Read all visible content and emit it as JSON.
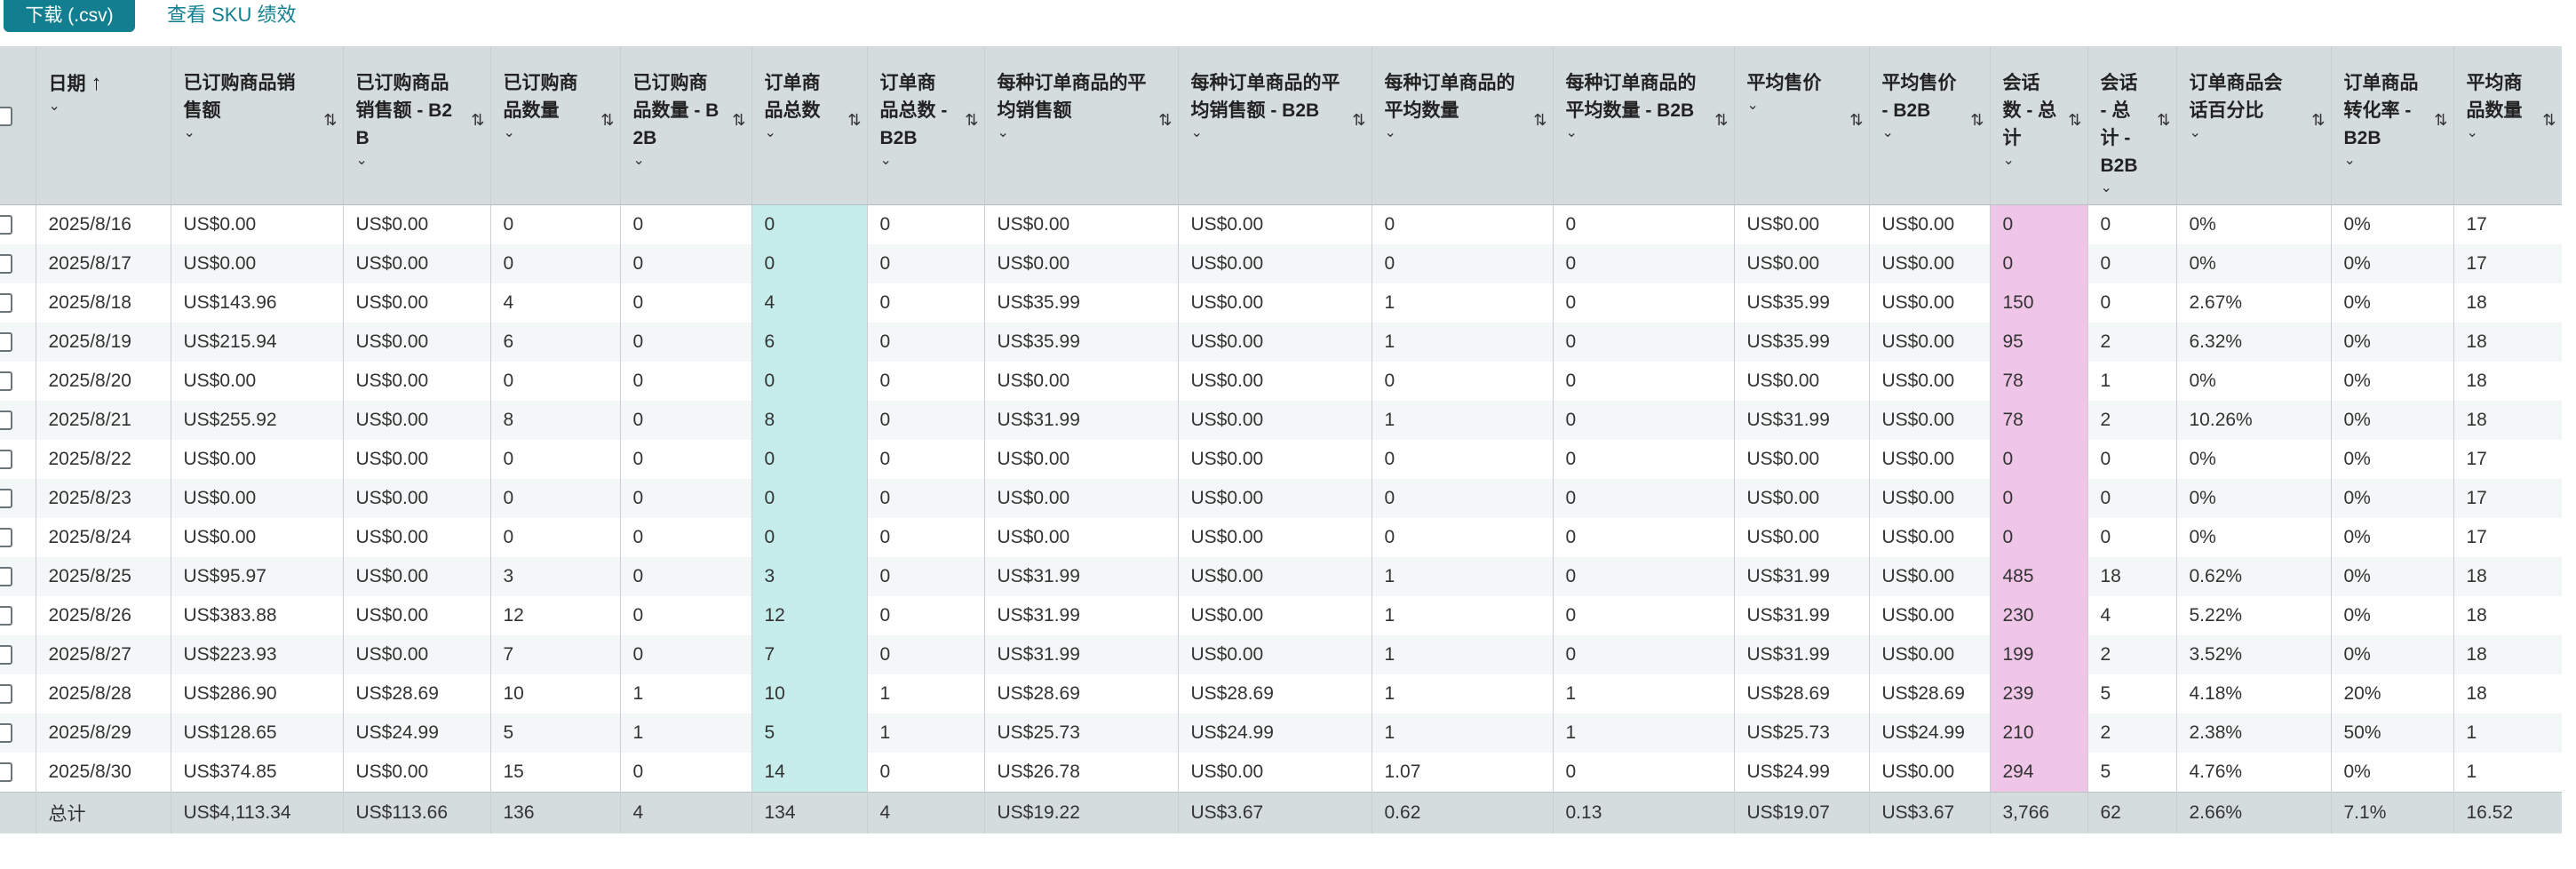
{
  "toolbar": {
    "download_label": "下载 (.csv)",
    "sku_link_label": "查看 SKU 绩效"
  },
  "table": {
    "columns": [
      {
        "label": "日期",
        "sort": "asc"
      },
      {
        "label": "已订购商品销售额"
      },
      {
        "label": "已订购商品销售额 - B2B"
      },
      {
        "label": "已订购商品数量"
      },
      {
        "label": "已订购商品数量 - B2B"
      },
      {
        "label": "订单商品总数"
      },
      {
        "label": "订单商品总数 - B2B"
      },
      {
        "label": "每种订单商品的平均销售额"
      },
      {
        "label": "每种订单商品的平均销售额 - B2B"
      },
      {
        "label": "每种订单商品的平均数量"
      },
      {
        "label": "每种订单商品的平均数量 - B2B"
      },
      {
        "label": "平均售价"
      },
      {
        "label": "平均售价 - B2B"
      },
      {
        "label": "会话数 - 总计"
      },
      {
        "label": "会话 - 总计 - B2B"
      },
      {
        "label": "订单商品会话百分比"
      },
      {
        "label": "订单商品转化率 - B2B"
      },
      {
        "label": "平均商品数量"
      }
    ],
    "rows": [
      [
        "2025/8/16",
        "US$0.00",
        "US$0.00",
        "0",
        "0",
        "0",
        "0",
        "US$0.00",
        "US$0.00",
        "0",
        "0",
        "US$0.00",
        "US$0.00",
        "0",
        "0",
        "0%",
        "0%",
        "17"
      ],
      [
        "2025/8/17",
        "US$0.00",
        "US$0.00",
        "0",
        "0",
        "0",
        "0",
        "US$0.00",
        "US$0.00",
        "0",
        "0",
        "US$0.00",
        "US$0.00",
        "0",
        "0",
        "0%",
        "0%",
        "17"
      ],
      [
        "2025/8/18",
        "US$143.96",
        "US$0.00",
        "4",
        "0",
        "4",
        "0",
        "US$35.99",
        "US$0.00",
        "1",
        "0",
        "US$35.99",
        "US$0.00",
        "150",
        "0",
        "2.67%",
        "0%",
        "18"
      ],
      [
        "2025/8/19",
        "US$215.94",
        "US$0.00",
        "6",
        "0",
        "6",
        "0",
        "US$35.99",
        "US$0.00",
        "1",
        "0",
        "US$35.99",
        "US$0.00",
        "95",
        "2",
        "6.32%",
        "0%",
        "18"
      ],
      [
        "2025/8/20",
        "US$0.00",
        "US$0.00",
        "0",
        "0",
        "0",
        "0",
        "US$0.00",
        "US$0.00",
        "0",
        "0",
        "US$0.00",
        "US$0.00",
        "78",
        "1",
        "0%",
        "0%",
        "18"
      ],
      [
        "2025/8/21",
        "US$255.92",
        "US$0.00",
        "8",
        "0",
        "8",
        "0",
        "US$31.99",
        "US$0.00",
        "1",
        "0",
        "US$31.99",
        "US$0.00",
        "78",
        "2",
        "10.26%",
        "0%",
        "18"
      ],
      [
        "2025/8/22",
        "US$0.00",
        "US$0.00",
        "0",
        "0",
        "0",
        "0",
        "US$0.00",
        "US$0.00",
        "0",
        "0",
        "US$0.00",
        "US$0.00",
        "0",
        "0",
        "0%",
        "0%",
        "17"
      ],
      [
        "2025/8/23",
        "US$0.00",
        "US$0.00",
        "0",
        "0",
        "0",
        "0",
        "US$0.00",
        "US$0.00",
        "0",
        "0",
        "US$0.00",
        "US$0.00",
        "0",
        "0",
        "0%",
        "0%",
        "17"
      ],
      [
        "2025/8/24",
        "US$0.00",
        "US$0.00",
        "0",
        "0",
        "0",
        "0",
        "US$0.00",
        "US$0.00",
        "0",
        "0",
        "US$0.00",
        "US$0.00",
        "0",
        "0",
        "0%",
        "0%",
        "17"
      ],
      [
        "2025/8/25",
        "US$95.97",
        "US$0.00",
        "3",
        "0",
        "3",
        "0",
        "US$31.99",
        "US$0.00",
        "1",
        "0",
        "US$31.99",
        "US$0.00",
        "485",
        "18",
        "0.62%",
        "0%",
        "18"
      ],
      [
        "2025/8/26",
        "US$383.88",
        "US$0.00",
        "12",
        "0",
        "12",
        "0",
        "US$31.99",
        "US$0.00",
        "1",
        "0",
        "US$31.99",
        "US$0.00",
        "230",
        "4",
        "5.22%",
        "0%",
        "18"
      ],
      [
        "2025/8/27",
        "US$223.93",
        "US$0.00",
        "7",
        "0",
        "7",
        "0",
        "US$31.99",
        "US$0.00",
        "1",
        "0",
        "US$31.99",
        "US$0.00",
        "199",
        "2",
        "3.52%",
        "0%",
        "18"
      ],
      [
        "2025/8/28",
        "US$286.90",
        "US$28.69",
        "10",
        "1",
        "10",
        "1",
        "US$28.69",
        "US$28.69",
        "1",
        "1",
        "US$28.69",
        "US$28.69",
        "239",
        "5",
        "4.18%",
        "20%",
        "18"
      ],
      [
        "2025/8/29",
        "US$128.65",
        "US$24.99",
        "5",
        "1",
        "5",
        "1",
        "US$25.73",
        "US$24.99",
        "1",
        "1",
        "US$25.73",
        "US$24.99",
        "210",
        "2",
        "2.38%",
        "50%",
        "1"
      ],
      [
        "2025/8/30",
        "US$374.85",
        "US$0.00",
        "15",
        "0",
        "14",
        "0",
        "US$26.78",
        "US$0.00",
        "1.07",
        "0",
        "US$24.99",
        "US$0.00",
        "294",
        "5",
        "4.76%",
        "0%",
        "1"
      ]
    ],
    "totals": [
      "总计",
      "US$4,113.34",
      "US$113.66",
      "136",
      "4",
      "134",
      "4",
      "US$19.22",
      "US$3.67",
      "0.62",
      "0.13",
      "US$19.07",
      "US$3.67",
      "3,766",
      "62",
      "2.66%",
      "7.1%",
      "16.52"
    ],
    "highlight_columns": {
      "cyan": 5,
      "pink": 13
    },
    "colors": {
      "header_bg": "#d5dcde",
      "cyan_highlight": "#c7ecec",
      "pink_highlight": "#efc6e7",
      "accent": "#117f8f"
    }
  }
}
